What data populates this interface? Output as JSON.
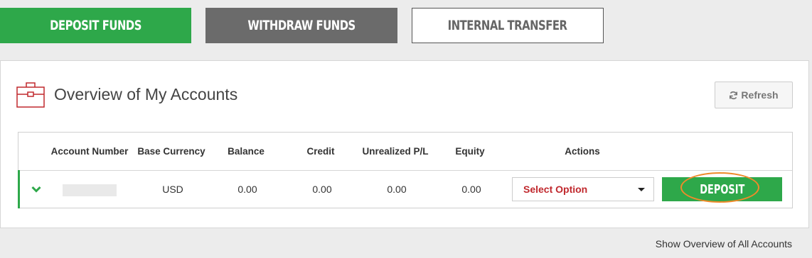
{
  "tabs": [
    {
      "label": "DEPOSIT FUNDS",
      "active": true
    },
    {
      "label": "WITHDRAW FUNDS"
    },
    {
      "label": "INTERNAL TRANSFER"
    }
  ],
  "panel": {
    "title": "Overview of My Accounts",
    "refresh_label": "Refresh"
  },
  "table": {
    "columns": [
      "Account Number",
      "Base Currency",
      "Balance",
      "Credit",
      "Unrealized P/L",
      "Equity",
      "Actions"
    ],
    "rows": [
      {
        "currency": "USD",
        "balance": "0.00",
        "credit": "0.00",
        "unrealized": "0.00",
        "equity": "0.00",
        "select_value": "Select Option",
        "deposit_label": "DEPOSIT"
      }
    ]
  },
  "footer": {
    "link": "Show Overview of All Accounts"
  },
  "colors": {
    "accent_green": "#2ea84a",
    "dark_gray": "#6b6b6b",
    "red": "#c0282d",
    "highlight_orange": "#f08a2a"
  },
  "icons": [
    "briefcase-icon",
    "refresh-icon",
    "chevron-down-icon",
    "caret-down-icon"
  ]
}
